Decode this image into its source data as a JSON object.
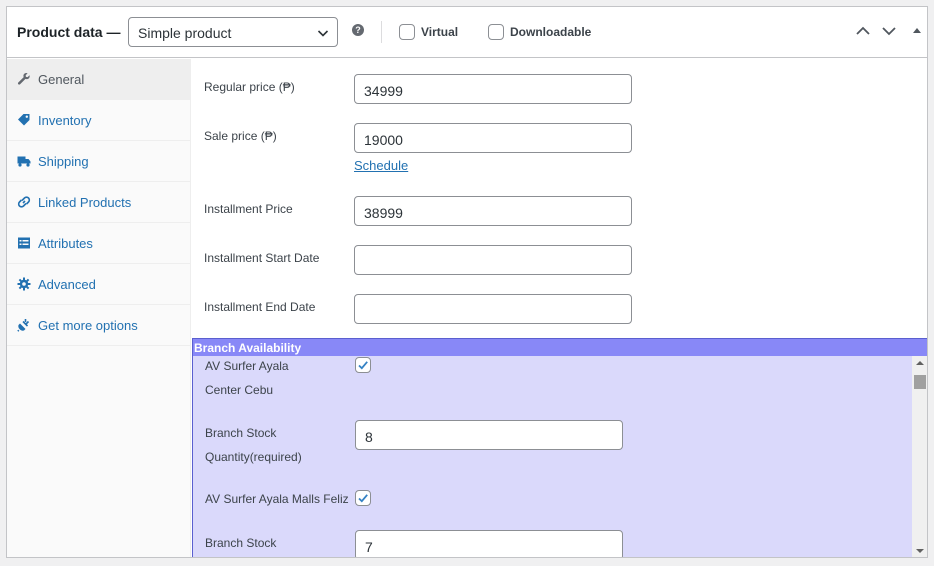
{
  "header": {
    "title": "Product data —",
    "product_type": "Simple product",
    "help_icon": "question-circle-icon",
    "virtual_label": "Virtual",
    "downloadable_label": "Downloadable"
  },
  "sidebar": {
    "items": [
      {
        "label": "General",
        "icon": "wrench-icon",
        "active": true
      },
      {
        "label": "Inventory",
        "icon": "tag-icon",
        "active": false
      },
      {
        "label": "Shipping",
        "icon": "truck-icon",
        "active": false
      },
      {
        "label": "Linked Products",
        "icon": "link-icon",
        "active": false
      },
      {
        "label": "Attributes",
        "icon": "list-icon",
        "active": false
      },
      {
        "label": "Advanced",
        "icon": "gear-icon",
        "active": false
      },
      {
        "label": "Get more options",
        "icon": "plugin-icon",
        "active": false
      }
    ]
  },
  "general": {
    "regular_price_label": "Regular price (₱)",
    "regular_price_value": "34999",
    "sale_price_label": "Sale price (₱)",
    "sale_price_value": "19000",
    "schedule_link": "Schedule",
    "installment_price_label": "Installment Price",
    "installment_price_value": "38999",
    "installment_start_label": "Installment Start Date",
    "installment_start_value": "",
    "installment_end_label": "Installment End Date",
    "installment_end_value": ""
  },
  "branch": {
    "title": "Branch Availability",
    "branches": [
      {
        "name_line1": "AV Surfer Ayala",
        "name_line2": "Center Cebu",
        "checked": true,
        "stock_label_line1": "Branch Stock",
        "stock_label_line2": "Quantity(required)",
        "stock_value": "8"
      },
      {
        "name_line1": "AV Surfer Ayala Malls Feliz",
        "name_line2": "",
        "checked": true,
        "stock_label_line1": "Branch Stock",
        "stock_label_line2": "",
        "stock_value": "7"
      }
    ]
  },
  "colors": {
    "link": "#2271b1",
    "branch_bg": "#dad9fb",
    "branch_title_bg": "#8888f7"
  }
}
